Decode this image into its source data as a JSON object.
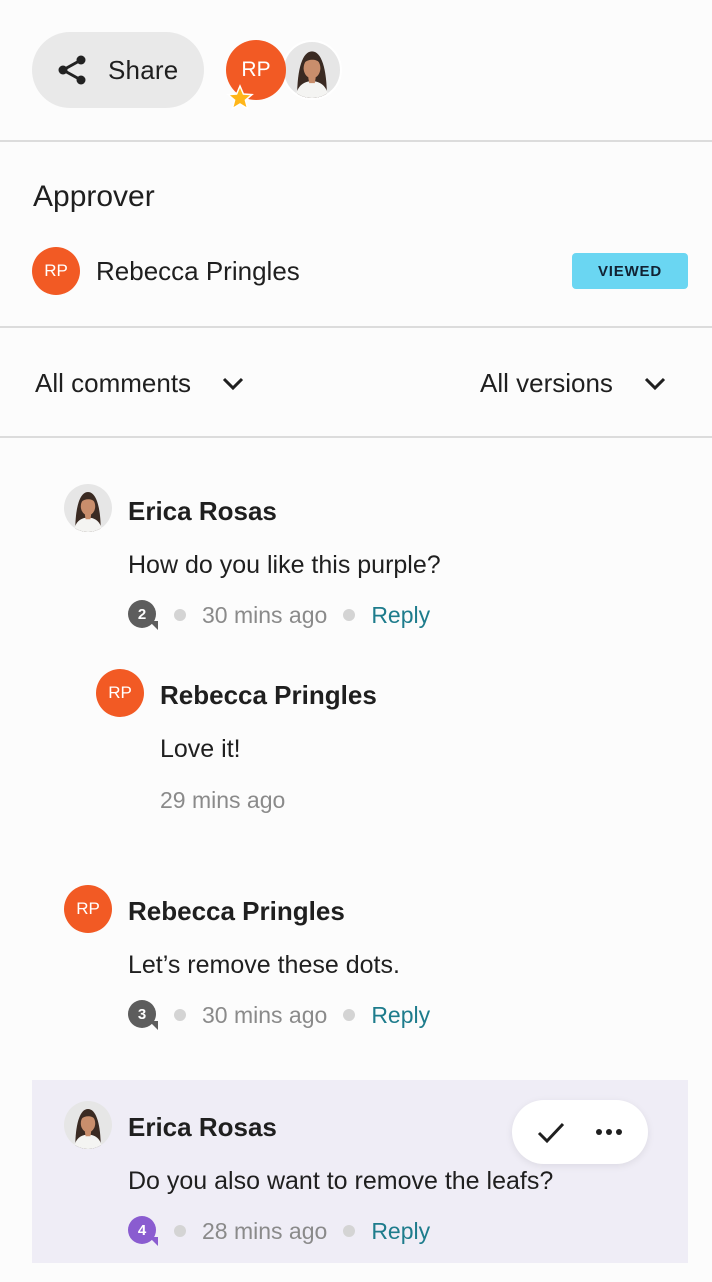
{
  "header": {
    "share_label": "Share",
    "avatar_initials": "RP",
    "share_icon": "share-icon",
    "star_icon": "star-icon"
  },
  "approver": {
    "title": "Approver",
    "initials": "RP",
    "name": "Rebecca Pringles",
    "status": "VIEWED"
  },
  "filters": {
    "comments": "All comments",
    "versions": "All versions"
  },
  "comments": [
    {
      "author": "Erica Rosas",
      "text": "How do you like this purple?",
      "count": "2",
      "time": "30 mins ago",
      "reply_label": "Reply",
      "reply": {
        "initials": "RP",
        "author": "Rebecca Pringles",
        "text": "Love it!",
        "time": "29 mins ago"
      }
    },
    {
      "initials": "RP",
      "author": "Rebecca Pringles",
      "text": "Let’s remove these dots.",
      "count": "3",
      "time": "30 mins ago",
      "reply_label": "Reply"
    },
    {
      "author": "Erica Rosas",
      "text": "Do you also want to remove the leafs?",
      "count": "4",
      "time": "28 mins ago",
      "reply_label": "Reply"
    }
  ],
  "colors": {
    "avatar_orange": "#f25a24",
    "badge_blue": "#6ad6f2",
    "reply_teal": "#1e7c8c",
    "count_gray": "#5d5d5d",
    "count_purple": "#8a5cd0",
    "highlight_bg": "#efedf6"
  }
}
